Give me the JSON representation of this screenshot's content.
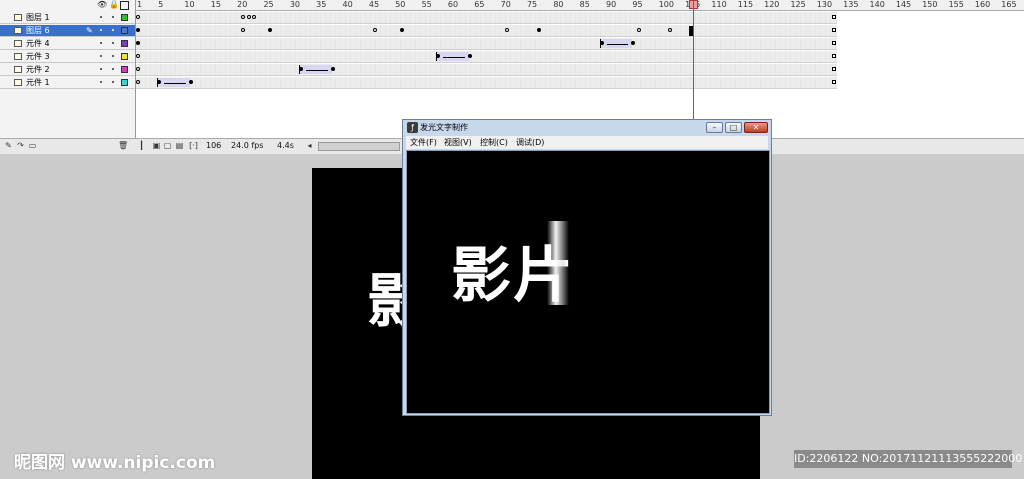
{
  "timeline": {
    "header_icons": [
      "eye-icon",
      "lock-icon",
      "outline-icon"
    ],
    "layers": [
      {
        "name": "图层 1",
        "color": "#2fbf2f",
        "selected": false
      },
      {
        "name": "图层 6",
        "color": "#4a78d0",
        "selected": true
      },
      {
        "name": "元件 4",
        "color": "#7a3fb0",
        "selected": false
      },
      {
        "name": "元件 3",
        "color": "#e8e830",
        "selected": false
      },
      {
        "name": "元件 2",
        "color": "#d040c0",
        "selected": false
      },
      {
        "name": "元件 1",
        "color": "#40d0d0",
        "selected": false
      }
    ],
    "ruler_labels": [
      "1",
      "5",
      "10",
      "15",
      "20",
      "25",
      "30",
      "35",
      "40",
      "45",
      "50",
      "55",
      "60",
      "65",
      "70",
      "75",
      "80",
      "85",
      "90",
      "95",
      "100",
      "105",
      "110",
      "115",
      "120",
      "125",
      "130",
      "135",
      "140",
      "145",
      "150",
      "155",
      "160",
      "165"
    ],
    "current_frame_marker": "106",
    "status": {
      "current_frame": "106",
      "frame_rate": "24.0 fps",
      "elapsed_time": "4.4s"
    }
  },
  "player": {
    "title": "发光文字制作",
    "menus": [
      "文件(F)",
      "视图(V)",
      "控制(C)",
      "调试(D)"
    ],
    "canvas_text": "影片"
  },
  "stage": {
    "canvas_text": "影"
  },
  "watermark": {
    "left": "昵图网 www.nipic.com",
    "right": "ID:2206122 NO:20171121113555222000"
  }
}
